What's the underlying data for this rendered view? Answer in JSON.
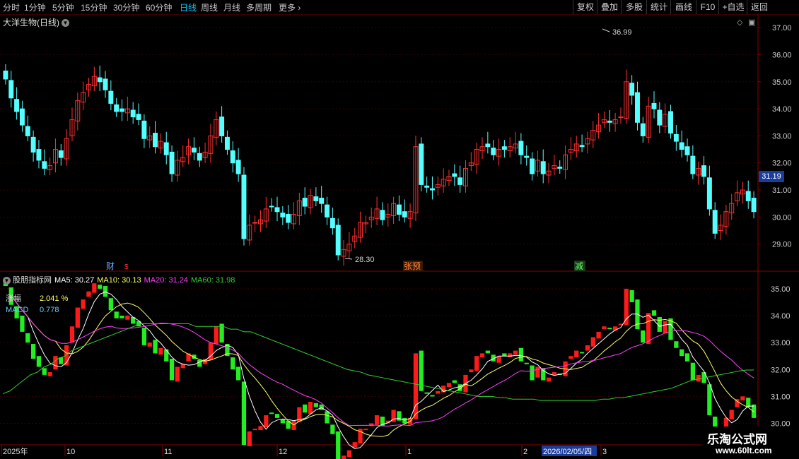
{
  "toolbar": {
    "timeframes": [
      "分时",
      "1分钟",
      "5分钟",
      "15分钟",
      "30分钟",
      "60分钟",
      "日线",
      "周线",
      "月线",
      "多周期",
      "更多"
    ],
    "active": "日线",
    "buttons": [
      "复权",
      "叠加",
      "多股",
      "统计",
      "画线",
      "F10",
      "+自选",
      "返回"
    ]
  },
  "main_title": "大洋生物(日线)",
  "indicator": {
    "name": "股朋指标网",
    "ma5": "MA5: 30.27",
    "ma10": "MA10: 30.13",
    "ma20": "MA20: 31.24",
    "ma60": "MA60: 31.98",
    "zf_label": "涨幅",
    "zf_value": "2.041 %",
    "macd_label": "MACD",
    "macd_value": "0.778"
  },
  "last_price": "31.19",
  "markers": {
    "cai": "财",
    "zhangyu": "张预",
    "jian": "减"
  },
  "watermark": {
    "title": "乐淘公式网",
    "url": "www.60lt.com"
  },
  "date_axis": [
    "2025年",
    "10",
    "11",
    "12",
    "1",
    "2",
    "3"
  ],
  "date_highlight": "2026/02/05/四",
  "colors": {
    "up": "#ff3030",
    "down": "#54ffff",
    "up_ind": "#ff1a1a",
    "down_ind": "#22ee22",
    "ma5": "#ffffff",
    "ma10": "#ffff66",
    "ma20": "#ff40ff",
    "ma60": "#30d030",
    "axis": "#8b0000"
  },
  "chart_data": {
    "type": "candlestick",
    "main_y_ticks": [
      "37.00",
      "36.00",
      "35.00",
      "34.00",
      "33.00",
      "32.00",
      "31.00",
      "30.00",
      "29.00"
    ],
    "main_ylim": [
      28.0,
      37.5
    ],
    "ind_y_ticks": [
      "35.00",
      "34.00",
      "33.00",
      "32.00",
      "31.00",
      "30.00"
    ],
    "ind_ylim": [
      29.2,
      35.6
    ],
    "high_label": "36.99",
    "low_label": "28.30",
    "closes": [
      35.1,
      34.4,
      33.9,
      33.4,
      33.0,
      32.4,
      32.1,
      31.8,
      31.9,
      32.5,
      32.2,
      32.9,
      33.6,
      34.3,
      34.6,
      34.9,
      35.2,
      35.0,
      34.7,
      34.2,
      33.9,
      33.9,
      34.0,
      33.7,
      33.6,
      32.9,
      33.0,
      32.6,
      32.8,
      32.3,
      31.6,
      32.1,
      32.2,
      32.6,
      32.4,
      32.1,
      32.4,
      33.0,
      33.6,
      33.0,
      32.5,
      32.0,
      31.6,
      29.2,
      29.7,
      29.8,
      29.9,
      30.3,
      30.4,
      30.2,
      30.0,
      29.8,
      30.1,
      30.6,
      30.4,
      30.8,
      30.6,
      30.5,
      30.0,
      29.6,
      28.6,
      28.8,
      29.0,
      29.3,
      29.8,
      29.8,
      30.0,
      30.3,
      29.9,
      30.1,
      30.5,
      30.1,
      30.0,
      30.2,
      32.6,
      31.2,
      31.1,
      31.0,
      31.2,
      31.4,
      31.5,
      31.5,
      31.2,
      31.8,
      32.0,
      32.5,
      32.6,
      32.6,
      32.3,
      32.5,
      32.5,
      32.6,
      32.7,
      32.3,
      32.2,
      31.6,
      32.1,
      31.6,
      31.7,
      31.9,
      31.8,
      32.3,
      32.5,
      32.7,
      32.6,
      32.9,
      33.2,
      33.4,
      33.6,
      33.5,
      33.6,
      33.7,
      35.0,
      34.5,
      33.5,
      33.0,
      34.1,
      34.0,
      33.4,
      33.8,
      33.1,
      32.8,
      32.5,
      32.3,
      31.6,
      31.8,
      31.5,
      30.3,
      29.4,
      29.7,
      30.2,
      30.5,
      30.9,
      31.0,
      30.6,
      30.2
    ],
    "ma60": [
      31.1,
      31.2,
      31.4,
      31.6,
      31.8,
      31.9,
      32.1,
      32.2,
      32.4,
      32.5,
      32.7,
      32.8,
      32.9,
      33.0,
      33.1,
      33.2,
      33.3,
      33.4,
      33.5,
      33.6,
      33.7,
      33.7,
      33.7,
      33.7,
      33.7,
      33.7,
      33.7,
      33.7,
      33.6,
      33.6,
      33.6,
      33.6,
      33.6,
      33.5,
      33.5,
      33.4,
      33.4,
      33.3,
      33.2,
      33.1,
      33.0,
      32.9,
      32.8,
      32.7,
      32.6,
      32.5,
      32.4,
      32.3,
      32.2,
      32.1,
      32.0,
      31.95,
      31.9,
      31.8,
      31.75,
      31.7,
      31.65,
      31.6,
      31.55,
      31.5,
      31.45,
      31.4,
      31.35,
      31.3,
      31.25,
      31.2,
      31.15,
      31.1,
      31.05,
      31.0,
      31.0,
      31.0,
      30.95,
      30.95,
      30.9,
      30.9,
      30.9,
      30.9,
      30.85,
      30.85,
      30.85,
      30.85,
      30.85,
      30.85,
      30.85,
      30.85,
      30.85,
      30.9,
      30.9,
      30.95,
      30.95,
      31.0,
      31.05,
      31.1,
      31.15,
      31.2,
      31.25,
      31.3,
      31.4,
      31.5,
      31.6,
      31.65,
      31.7,
      31.75,
      31.8,
      31.85,
      31.9,
      31.95,
      31.98,
      31.98
    ]
  }
}
